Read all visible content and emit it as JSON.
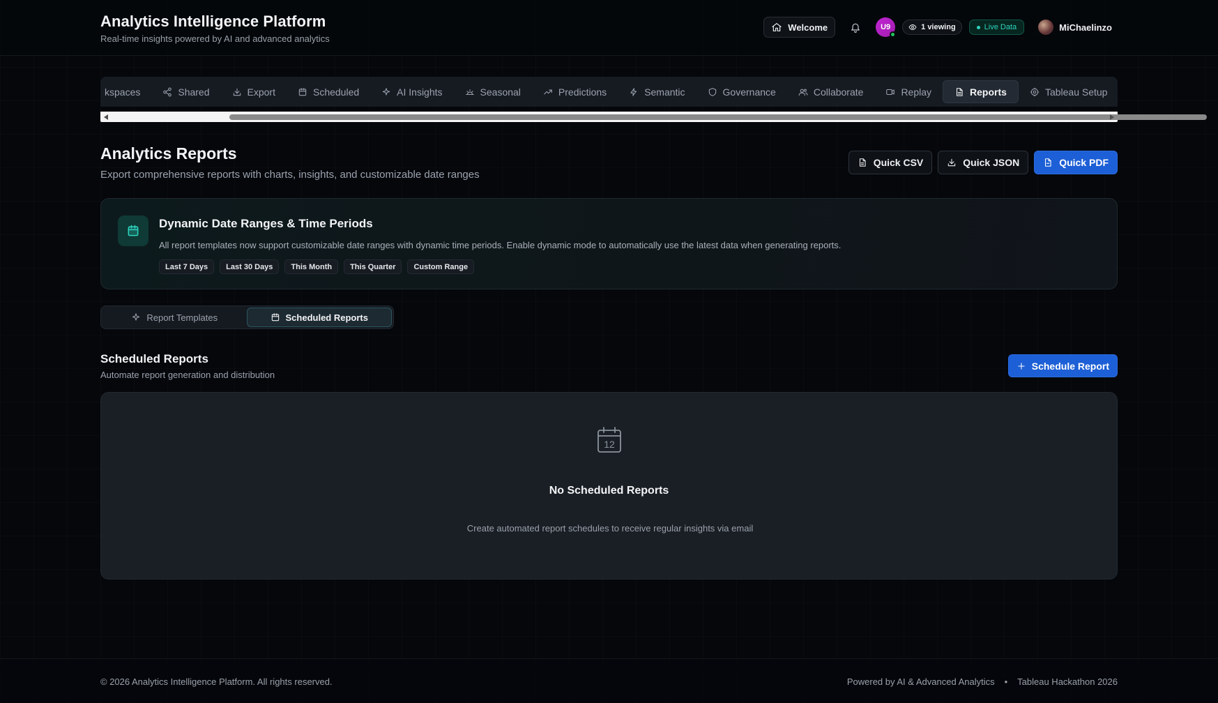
{
  "header": {
    "title": "Analytics Intelligence Platform",
    "subtitle": "Real-time insights powered by AI and advanced analytics",
    "welcome_label": "Welcome",
    "avatar_initials": "U9",
    "viewing_label": "1 viewing",
    "live_label": "Live Data",
    "username": "MiChaelinzo"
  },
  "tabs": [
    {
      "label": "kspaces",
      "icon": "workspace-icon"
    },
    {
      "label": "Shared",
      "icon": "share-icon"
    },
    {
      "label": "Export",
      "icon": "download-icon"
    },
    {
      "label": "Scheduled",
      "icon": "calendar-icon"
    },
    {
      "label": "AI Insights",
      "icon": "sparkle-icon"
    },
    {
      "label": "Seasonal",
      "icon": "sun-icon"
    },
    {
      "label": "Predictions",
      "icon": "trend-up-icon"
    },
    {
      "label": "Semantic",
      "icon": "lightning-icon"
    },
    {
      "label": "Governance",
      "icon": "shield-icon"
    },
    {
      "label": "Collaborate",
      "icon": "users-icon"
    },
    {
      "label": "Replay",
      "icon": "video-icon"
    },
    {
      "label": "Reports",
      "icon": "file-icon",
      "active": true
    },
    {
      "label": "Tableau Setup",
      "icon": "gear-icon"
    }
  ],
  "page": {
    "title": "Analytics Reports",
    "subtitle": "Export comprehensive reports with charts, insights, and customizable date ranges",
    "quick_csv": "Quick CSV",
    "quick_json": "Quick JSON",
    "quick_pdf": "Quick PDF"
  },
  "info_card": {
    "title": "Dynamic Date Ranges & Time Periods",
    "text": "All report templates now support customizable date ranges with dynamic time periods. Enable dynamic mode to automatically use the latest data when generating reports.",
    "chips": [
      "Last 7 Days",
      "Last 30 Days",
      "This Month",
      "This Quarter",
      "Custom Range"
    ]
  },
  "toggle": {
    "templates_label": "Report Templates",
    "scheduled_label": "Scheduled Reports",
    "active": "scheduled"
  },
  "scheduled": {
    "title": "Scheduled Reports",
    "subtitle": "Automate report generation and distribution",
    "button_label": "Schedule Report",
    "empty_icon_day": "12",
    "empty_title": "No Scheduled Reports",
    "empty_text": "Create automated report schedules to receive regular insights via email"
  },
  "footer": {
    "copyright": "© 2026 Analytics Intelligence Platform. All rights reserved.",
    "powered": "Powered by AI & Advanced Analytics",
    "separator": "•",
    "event": "Tableau Hackathon 2026"
  },
  "colors": {
    "background": "#05070b",
    "accent_blue": "#1d5fd6",
    "accent_teal": "#2dd4bf",
    "avatar_magenta": "#c026d3",
    "online_green": "#22c55e"
  }
}
